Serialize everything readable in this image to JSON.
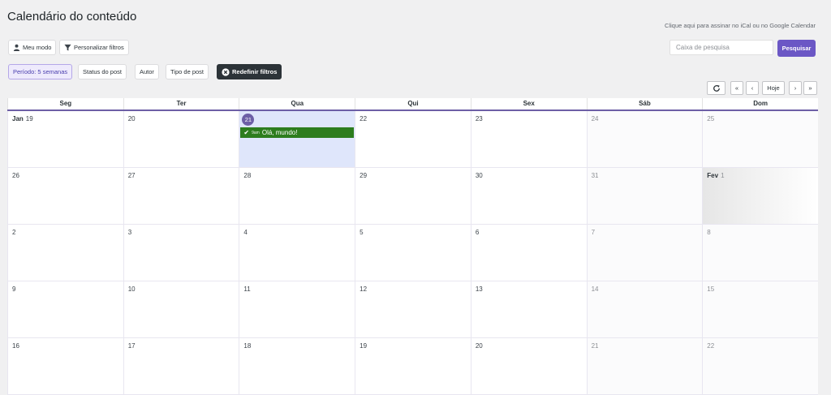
{
  "header": {
    "title": "Calendário do conteúdo",
    "ical_link": "Clique aqui para assinar no iCal ou no Google Calendar"
  },
  "toolbar": {
    "my_mode": "Meu modo",
    "customize_filters": "Personalizar filtros",
    "period": "Período: 5 semanas",
    "post_status": "Status do post",
    "author": "Autor",
    "post_type": "Tipo de post",
    "reset_filters": "Redefinir filtros"
  },
  "search": {
    "placeholder": "Caixa de pesquisa",
    "button": "Pesquisar"
  },
  "nav": {
    "first": "«",
    "prev": "‹",
    "today": "Hoje",
    "next": "›",
    "last": "»"
  },
  "calendar": {
    "weekdays": [
      "Seg",
      "Ter",
      "Qua",
      "Qui",
      "Sex",
      "Sáb",
      "Dom"
    ],
    "weeks": [
      [
        {
          "d": "19",
          "m": "Jan"
        },
        {
          "d": "20"
        },
        {
          "d": "21",
          "today": true,
          "event": {
            "time": "9am",
            "title": "Olá, mundo!"
          }
        },
        {
          "d": "22"
        },
        {
          "d": "23"
        },
        {
          "d": "24",
          "w": true
        },
        {
          "d": "25",
          "w": true
        }
      ],
      [
        {
          "d": "26"
        },
        {
          "d": "27"
        },
        {
          "d": "28"
        },
        {
          "d": "29"
        },
        {
          "d": "30"
        },
        {
          "d": "31",
          "w": true
        },
        {
          "d": "1",
          "m": "Fev",
          "w": true,
          "fev": true
        }
      ],
      [
        {
          "d": "2"
        },
        {
          "d": "3"
        },
        {
          "d": "4"
        },
        {
          "d": "5"
        },
        {
          "d": "6"
        },
        {
          "d": "7",
          "w": true
        },
        {
          "d": "8",
          "w": true
        }
      ],
      [
        {
          "d": "9"
        },
        {
          "d": "10"
        },
        {
          "d": "11"
        },
        {
          "d": "12"
        },
        {
          "d": "13"
        },
        {
          "d": "14",
          "w": true
        },
        {
          "d": "15",
          "w": true
        }
      ],
      [
        {
          "d": "16"
        },
        {
          "d": "17"
        },
        {
          "d": "18"
        },
        {
          "d": "19"
        },
        {
          "d": "20"
        },
        {
          "d": "21",
          "w": true
        },
        {
          "d": "22",
          "w": true
        }
      ]
    ]
  },
  "colors": {
    "accent": "#6b57c5",
    "event": "#2d7d1e",
    "today_bg": "#dfe6fb"
  }
}
